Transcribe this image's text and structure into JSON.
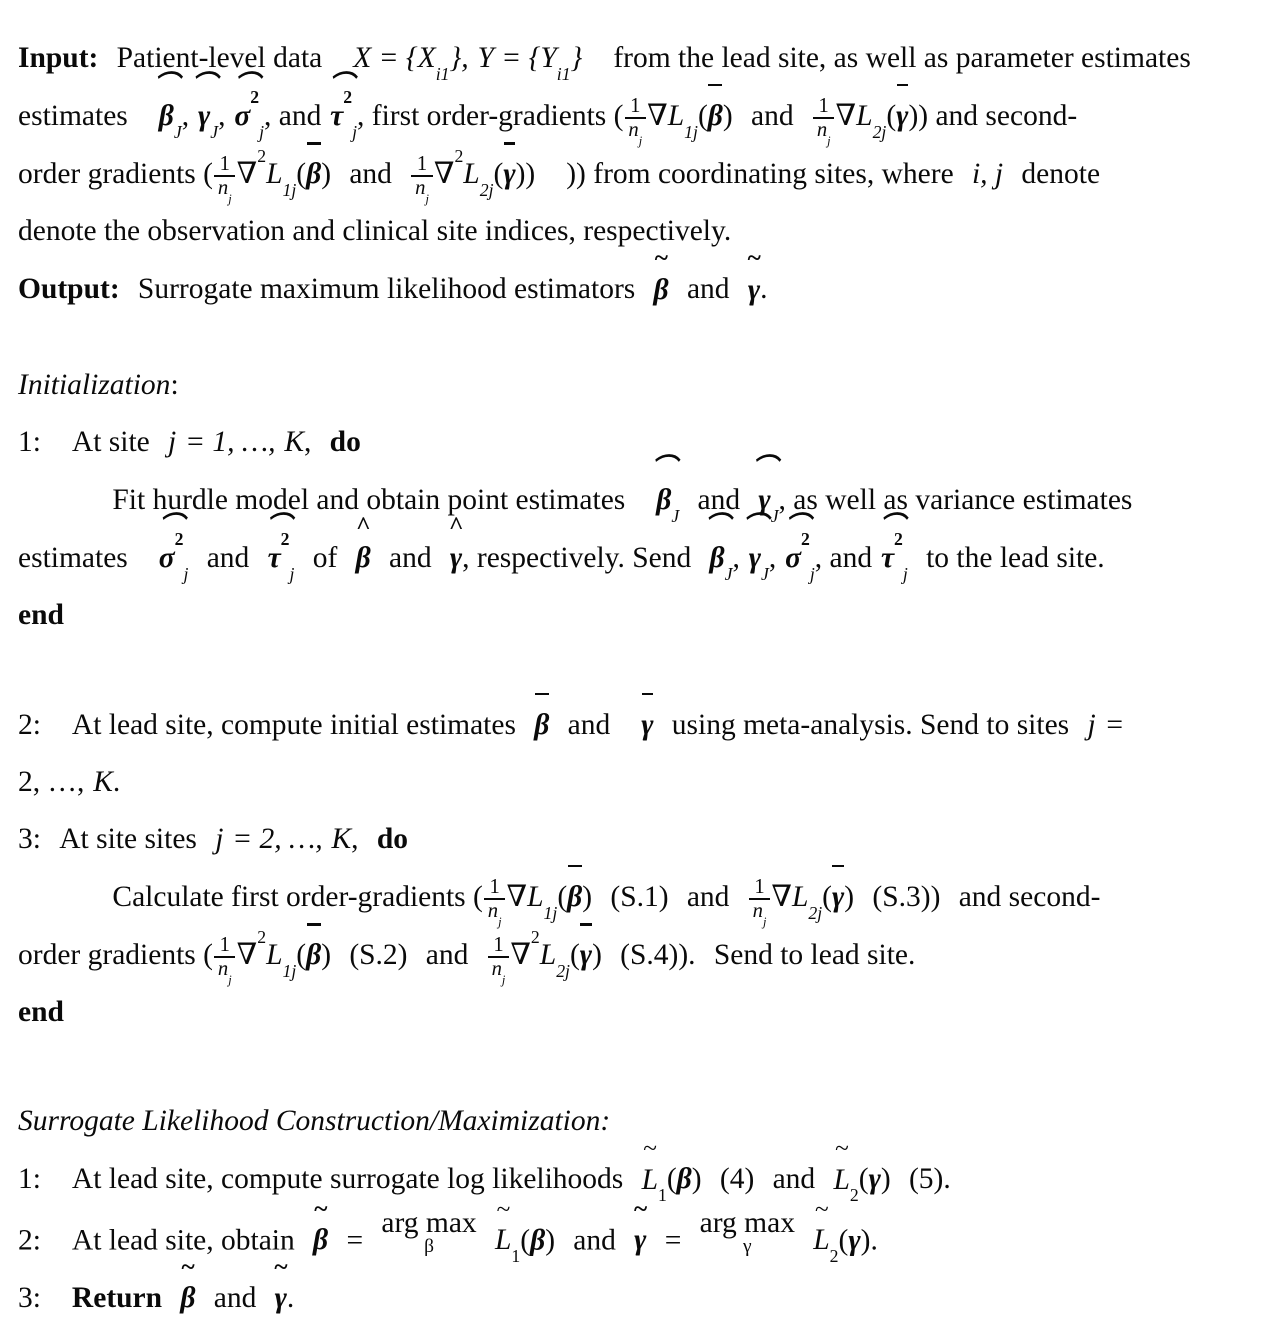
{
  "document": {
    "type": "algorithm-pseudocode",
    "font_color": "#0a0a0a",
    "background": "#ffffff"
  },
  "input_block": {
    "label": "Input:",
    "text_1": "Patient-level data",
    "math_X": "X = {X",
    "sub_i1": "i1",
    "math_X_close": "},",
    "math_Y": "Y = {Y",
    "sub_i1_b": "i1",
    "math_Y_close": "}",
    "text_2": "from the lead site, as well as parameter estimates",
    "beta_hat_J": "β",
    "gamma_hat_J": "γ",
    "sigma_hat_sq_j": "σ",
    "and_1": ", and",
    "tau_hat_sq_j": "τ",
    "text_3": ", first order-gradients (",
    "frac_num": "1",
    "frac_den": "n",
    "frac_den_sub": "j",
    "grad_L1j": "L",
    "grad_L1j_sub": "1j",
    "beta_bar": "β",
    "and_2": "and",
    "grad_L2j": "L",
    "grad_L2j_sub": "2j",
    "gamma_bar": "γ",
    "text_4": ")) and second-order gradients (",
    "grad2_L1j_sub": "1j",
    "grad2_L2j_sub": "2j",
    "text_5": ")) from coordinating sites, where",
    "indices": "i, j",
    "text_6": "denote the observation and clinical site indices, respectively."
  },
  "output_block": {
    "label": "Output:",
    "text": "Surrogate maximum likelihood estimators",
    "beta_tilde": "β",
    "and": "and",
    "gamma_tilde": "γ",
    "period": "."
  },
  "initialization": {
    "heading": "Initialization",
    "heading_colon": ":",
    "step1_num": "1:",
    "step1_text_a": "At site",
    "step1_j": "j",
    "step1_eq": "= 1, …,",
    "step1_K": "K",
    "step1_comma": ",",
    "step1_do": "do",
    "body_line1_a": "Fit hurdle model and obtain point estimates",
    "body_beta_hat_J": "β",
    "body_and": "and",
    "body_gamma_hat_J": "γ",
    "body_line1_b": ", as well as variance estimates",
    "body_sigma_sq_j": "σ",
    "body_and2": "and",
    "body_tau_sq_j": "τ",
    "body_of": "of",
    "body_beta_hat": "β",
    "body_and3": "and",
    "body_gamma_hat": "γ",
    "body_resp": ", respectively. Send",
    "send_beta": "β",
    "send_gamma": "γ",
    "send_sigma": "σ",
    "send_and": ", and",
    "send_tau": "τ",
    "send_tail": "to the lead site.",
    "end": "end"
  },
  "main_loop": {
    "step2_num": "2:",
    "step2_text_a": "At lead site, compute initial estimates",
    "step2_beta_bar": "β",
    "step2_and": "and",
    "step2_gamma_bar": "γ",
    "step2_text_b": "using meta-analysis. Send to sites",
    "step2_j": "j",
    "step2_eq": "=",
    "step2_range": "2, …,",
    "step2_K": "K",
    "step2_period": ".",
    "step3_num": "3:",
    "step3_text": "At site sites",
    "step3_j": "j",
    "step3_eq": "= 2, …,",
    "step3_K": "K",
    "step3_comma": ",",
    "step3_do": "do",
    "body_calc": "Calculate first order-gradients (",
    "frac_num": "1",
    "frac_den": "n",
    "frac_den_sub": "j",
    "L1j": "L",
    "L1j_sub": "1j",
    "beta_bar": "β",
    "ref_s1": "(S.1)",
    "and": "and",
    "L2j": "L",
    "L2j_sub": "2j",
    "gamma_bar": "γ",
    "ref_s3": "(S.3))",
    "tail_second": "and second-order gradients (",
    "ref_s2": "(S.2)",
    "ref_s4": "(S.4)).",
    "send_lead": "Send to lead site.",
    "end": "end"
  },
  "surrogate": {
    "heading": "Surrogate Likelihood Construction/Maximization:",
    "step1_num": "1:",
    "step1_text": "At lead site, compute surrogate log likelihoods",
    "step1_L1": "L",
    "step1_L1_sub": "1",
    "step1_beta": "β",
    "step1_ref4": "(4)",
    "step1_and": "and",
    "step1_L2": "L",
    "step1_L2_sub": "2",
    "step1_gamma": "γ",
    "step1_ref5": "(5).",
    "step2_num": "2:",
    "step2_text": "At lead site, obtain",
    "step2_beta_tilde": "β",
    "step2_eq": "=",
    "step2_arg": "arg max",
    "step2_under_beta": "β",
    "step2_L1": "L",
    "step2_L1_sub": "1",
    "step2_L1_arg": "β",
    "step2_and": "and",
    "step2_gamma_tilde": "γ",
    "step2_eq2": "=",
    "step2_arg2": "arg max",
    "step2_under_gamma": "γ",
    "step2_L2": "L",
    "step2_L2_sub": "2",
    "step2_L2_arg": "γ",
    "step2_period": ".",
    "step3_num": "3:",
    "step3_return": "Return",
    "step3_beta_tilde": "β",
    "step3_and": "and",
    "step3_gamma_tilde": "γ",
    "step3_period": "."
  },
  "symbols": {
    "nabla": "∇",
    "hat": "^",
    "bar": "¯",
    "tilde": "~",
    "squared": "2",
    "lbrace": "{",
    "rbrace": "}",
    "lparen": "(",
    "rparen": ")"
  }
}
